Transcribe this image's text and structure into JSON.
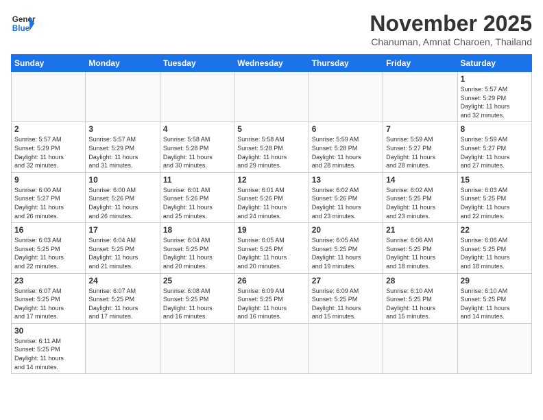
{
  "header": {
    "logo_general": "General",
    "logo_blue": "Blue",
    "month_title": "November 2025",
    "location": "Chanuman, Amnat Charoen, Thailand"
  },
  "weekdays": [
    "Sunday",
    "Monday",
    "Tuesday",
    "Wednesday",
    "Thursday",
    "Friday",
    "Saturday"
  ],
  "weeks": [
    [
      {
        "day": "",
        "info": ""
      },
      {
        "day": "",
        "info": ""
      },
      {
        "day": "",
        "info": ""
      },
      {
        "day": "",
        "info": ""
      },
      {
        "day": "",
        "info": ""
      },
      {
        "day": "",
        "info": ""
      },
      {
        "day": "1",
        "info": "Sunrise: 5:57 AM\nSunset: 5:29 PM\nDaylight: 11 hours\nand 32 minutes."
      }
    ],
    [
      {
        "day": "2",
        "info": "Sunrise: 5:57 AM\nSunset: 5:29 PM\nDaylight: 11 hours\nand 32 minutes."
      },
      {
        "day": "3",
        "info": "Sunrise: 5:57 AM\nSunset: 5:29 PM\nDaylight: 11 hours\nand 31 minutes."
      },
      {
        "day": "4",
        "info": "Sunrise: 5:58 AM\nSunset: 5:28 PM\nDaylight: 11 hours\nand 30 minutes."
      },
      {
        "day": "5",
        "info": "Sunrise: 5:58 AM\nSunset: 5:28 PM\nDaylight: 11 hours\nand 29 minutes."
      },
      {
        "day": "6",
        "info": "Sunrise: 5:59 AM\nSunset: 5:28 PM\nDaylight: 11 hours\nand 28 minutes."
      },
      {
        "day": "7",
        "info": "Sunrise: 5:59 AM\nSunset: 5:27 PM\nDaylight: 11 hours\nand 28 minutes."
      },
      {
        "day": "8",
        "info": "Sunrise: 5:59 AM\nSunset: 5:27 PM\nDaylight: 11 hours\nand 27 minutes."
      }
    ],
    [
      {
        "day": "9",
        "info": "Sunrise: 6:00 AM\nSunset: 5:27 PM\nDaylight: 11 hours\nand 26 minutes."
      },
      {
        "day": "10",
        "info": "Sunrise: 6:00 AM\nSunset: 5:26 PM\nDaylight: 11 hours\nand 26 minutes."
      },
      {
        "day": "11",
        "info": "Sunrise: 6:01 AM\nSunset: 5:26 PM\nDaylight: 11 hours\nand 25 minutes."
      },
      {
        "day": "12",
        "info": "Sunrise: 6:01 AM\nSunset: 5:26 PM\nDaylight: 11 hours\nand 24 minutes."
      },
      {
        "day": "13",
        "info": "Sunrise: 6:02 AM\nSunset: 5:26 PM\nDaylight: 11 hours\nand 23 minutes."
      },
      {
        "day": "14",
        "info": "Sunrise: 6:02 AM\nSunset: 5:25 PM\nDaylight: 11 hours\nand 23 minutes."
      },
      {
        "day": "15",
        "info": "Sunrise: 6:03 AM\nSunset: 5:25 PM\nDaylight: 11 hours\nand 22 minutes."
      }
    ],
    [
      {
        "day": "16",
        "info": "Sunrise: 6:03 AM\nSunset: 5:25 PM\nDaylight: 11 hours\nand 22 minutes."
      },
      {
        "day": "17",
        "info": "Sunrise: 6:04 AM\nSunset: 5:25 PM\nDaylight: 11 hours\nand 21 minutes."
      },
      {
        "day": "18",
        "info": "Sunrise: 6:04 AM\nSunset: 5:25 PM\nDaylight: 11 hours\nand 20 minutes."
      },
      {
        "day": "19",
        "info": "Sunrise: 6:05 AM\nSunset: 5:25 PM\nDaylight: 11 hours\nand 20 minutes."
      },
      {
        "day": "20",
        "info": "Sunrise: 6:05 AM\nSunset: 5:25 PM\nDaylight: 11 hours\nand 19 minutes."
      },
      {
        "day": "21",
        "info": "Sunrise: 6:06 AM\nSunset: 5:25 PM\nDaylight: 11 hours\nand 18 minutes."
      },
      {
        "day": "22",
        "info": "Sunrise: 6:06 AM\nSunset: 5:25 PM\nDaylight: 11 hours\nand 18 minutes."
      }
    ],
    [
      {
        "day": "23",
        "info": "Sunrise: 6:07 AM\nSunset: 5:25 PM\nDaylight: 11 hours\nand 17 minutes."
      },
      {
        "day": "24",
        "info": "Sunrise: 6:07 AM\nSunset: 5:25 PM\nDaylight: 11 hours\nand 17 minutes."
      },
      {
        "day": "25",
        "info": "Sunrise: 6:08 AM\nSunset: 5:25 PM\nDaylight: 11 hours\nand 16 minutes."
      },
      {
        "day": "26",
        "info": "Sunrise: 6:09 AM\nSunset: 5:25 PM\nDaylight: 11 hours\nand 16 minutes."
      },
      {
        "day": "27",
        "info": "Sunrise: 6:09 AM\nSunset: 5:25 PM\nDaylight: 11 hours\nand 15 minutes."
      },
      {
        "day": "28",
        "info": "Sunrise: 6:10 AM\nSunset: 5:25 PM\nDaylight: 11 hours\nand 15 minutes."
      },
      {
        "day": "29",
        "info": "Sunrise: 6:10 AM\nSunset: 5:25 PM\nDaylight: 11 hours\nand 14 minutes."
      }
    ],
    [
      {
        "day": "30",
        "info": "Sunrise: 6:11 AM\nSunset: 5:25 PM\nDaylight: 11 hours\nand 14 minutes."
      },
      {
        "day": "",
        "info": ""
      },
      {
        "day": "",
        "info": ""
      },
      {
        "day": "",
        "info": ""
      },
      {
        "day": "",
        "info": ""
      },
      {
        "day": "",
        "info": ""
      },
      {
        "day": "",
        "info": ""
      }
    ]
  ]
}
